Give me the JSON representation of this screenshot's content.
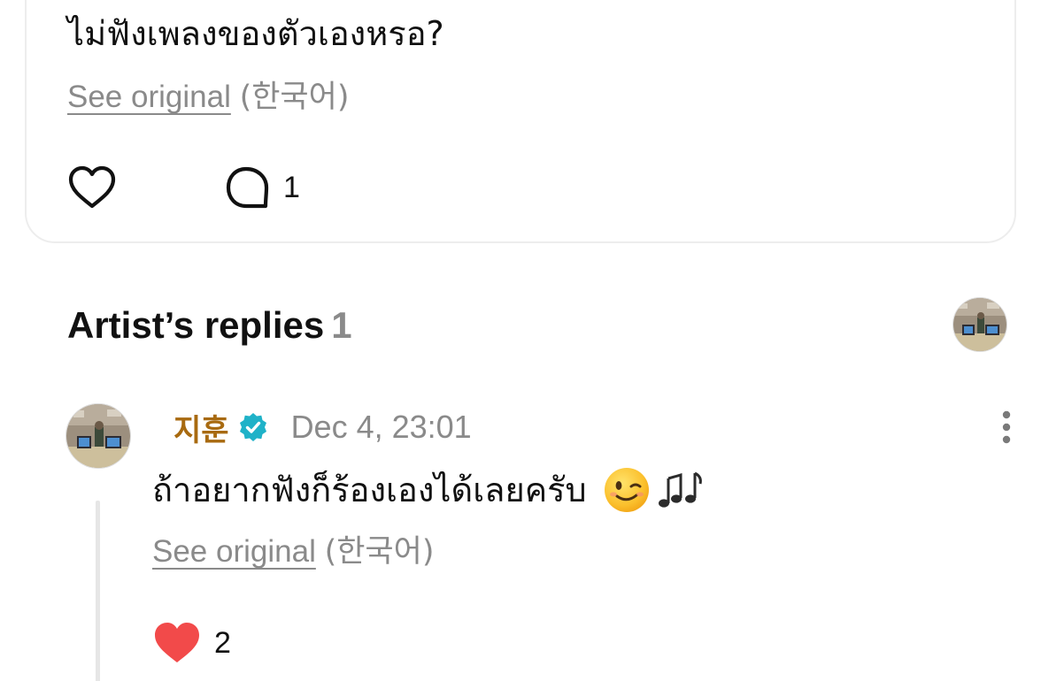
{
  "post": {
    "text": "ไม่ฟังเพลงของตัวเองหรอ?",
    "see_original": "See original",
    "original_language": "(한국어)",
    "comment_count": "1"
  },
  "replies_section": {
    "title": "Artist’s replies",
    "count": "1"
  },
  "reply": {
    "author": "지훈",
    "date": "Dec 4, 23:01",
    "text": "ถ้าอยากฟังก็ร้องเองได้เลยครับ",
    "see_original": "See original",
    "original_language": "(한국어)",
    "like_count": "2"
  },
  "colors": {
    "author_name": "#a86a10",
    "verified_badge": "#1fb2c8",
    "heart_filled": "#f24a4a",
    "muted_text": "#8a8a8a"
  },
  "icons": [
    "heart-outline-icon",
    "comment-bubble-icon",
    "verified-badge-icon",
    "more-vertical-icon",
    "heart-filled-icon",
    "winking-face-emoji",
    "music-notes-emoji"
  ]
}
